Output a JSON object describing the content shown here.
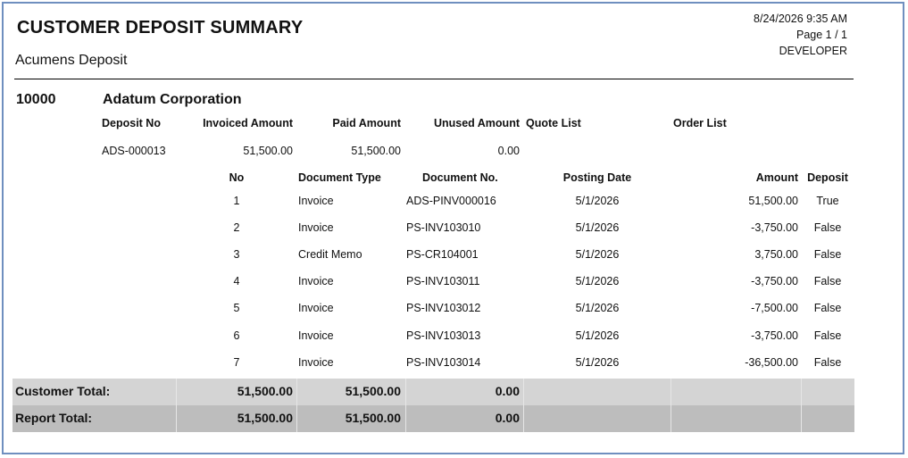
{
  "report": {
    "title": "CUSTOMER DEPOSIT SUMMARY",
    "subtitle": "Acumens Deposit",
    "datetime": "8/24/2026 9:35 AM",
    "page": "Page 1 / 1",
    "user": "DEVELOPER"
  },
  "customer": {
    "id": "10000",
    "name": "Adatum Corporation"
  },
  "deposit_headers": {
    "deposit_no": "Deposit No",
    "invoiced_amount": "Invoiced Amount",
    "paid_amount": "Paid Amount",
    "unused_amount": "Unused Amount",
    "quote_list": "Quote List",
    "order_list": "Order List"
  },
  "deposit": {
    "deposit_no": "ADS-000013",
    "invoiced_amount": "51,500.00",
    "paid_amount": "51,500.00",
    "unused_amount": "0.00"
  },
  "detail_headers": {
    "no": "No",
    "document_type": "Document Type",
    "document_no": "Document No.",
    "posting_date": "Posting Date",
    "amount": "Amount",
    "deposit": "Deposit"
  },
  "detail_rows": [
    {
      "no": "1",
      "type": "Invoice",
      "doc": "ADS-PINV000016",
      "date": "5/1/2026",
      "amount": "51,500.00",
      "deposit": "True"
    },
    {
      "no": "2",
      "type": "Invoice",
      "doc": "PS-INV103010",
      "date": "5/1/2026",
      "amount": "-3,750.00",
      "deposit": "False"
    },
    {
      "no": "3",
      "type": "Credit Memo",
      "doc": "PS-CR104001",
      "date": "5/1/2026",
      "amount": "3,750.00",
      "deposit": "False"
    },
    {
      "no": "4",
      "type": "Invoice",
      "doc": "PS-INV103011",
      "date": "5/1/2026",
      "amount": "-3,750.00",
      "deposit": "False"
    },
    {
      "no": "5",
      "type": "Invoice",
      "doc": "PS-INV103012",
      "date": "5/1/2026",
      "amount": "-7,500.00",
      "deposit": "False"
    },
    {
      "no": "6",
      "type": "Invoice",
      "doc": "PS-INV103013",
      "date": "5/1/2026",
      "amount": "-3,750.00",
      "deposit": "False"
    },
    {
      "no": "7",
      "type": "Invoice",
      "doc": "PS-INV103014",
      "date": "5/1/2026",
      "amount": "-36,500.00",
      "deposit": "False"
    }
  ],
  "customer_total": {
    "label": "Customer Total:",
    "invoiced": "51,500.00",
    "paid": "51,500.00",
    "unused": "0.00"
  },
  "report_total": {
    "label": "Report Total:",
    "invoiced": "51,500.00",
    "paid": "51,500.00",
    "unused": "0.00"
  }
}
